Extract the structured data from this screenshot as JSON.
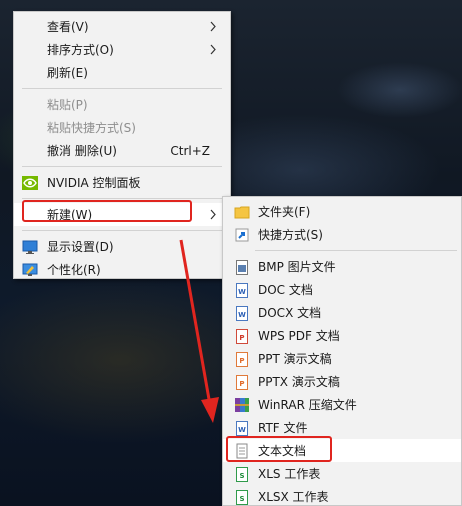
{
  "main_menu": {
    "items": [
      {
        "label": "查看(V)",
        "submenu": true
      },
      {
        "label": "排序方式(O)",
        "submenu": true
      },
      {
        "label": "刷新(E)"
      },
      {
        "label": "粘贴(P)",
        "disabled": true
      },
      {
        "label": "粘贴快捷方式(S)",
        "disabled": true
      },
      {
        "label": "撤消 删除(U)",
        "shortcut": "Ctrl+Z"
      },
      {
        "label": "NVIDIA 控制面板",
        "icon": "nvidia-icon"
      },
      {
        "label": "新建(W)",
        "submenu": true,
        "highlighted": true
      },
      {
        "label": "显示设置(D)",
        "icon": "display-settings-icon"
      },
      {
        "label": "个性化(R)",
        "icon": "personalize-icon"
      }
    ]
  },
  "new_submenu": {
    "items": [
      {
        "label": "文件夹(F)",
        "icon": "folder-icon"
      },
      {
        "label": "快捷方式(S)",
        "icon": "shortcut-icon"
      },
      {
        "label": "BMP 图片文件",
        "icon": "bmp-file-icon"
      },
      {
        "label": "DOC 文档",
        "icon": "doc-file-icon"
      },
      {
        "label": "DOCX 文档",
        "icon": "docx-file-icon"
      },
      {
        "label": "WPS PDF 文档",
        "icon": "pdf-file-icon"
      },
      {
        "label": "PPT 演示文稿",
        "icon": "ppt-file-icon"
      },
      {
        "label": "PPTX 演示文稿",
        "icon": "pptx-file-icon"
      },
      {
        "label": "WinRAR 压缩文件",
        "icon": "winrar-icon"
      },
      {
        "label": "RTF 文件",
        "icon": "rtf-file-icon"
      },
      {
        "label": "文本文档",
        "icon": "text-file-icon",
        "highlighted": true
      },
      {
        "label": "XLS 工作表",
        "icon": "xls-file-icon"
      },
      {
        "label": "XLSX 工作表",
        "icon": "xlsx-file-icon"
      }
    ]
  },
  "colors": {
    "menu_bg": "#f2f2f2",
    "annotation_red": "#e0251f",
    "disabled_text": "#8e8e8e"
  }
}
